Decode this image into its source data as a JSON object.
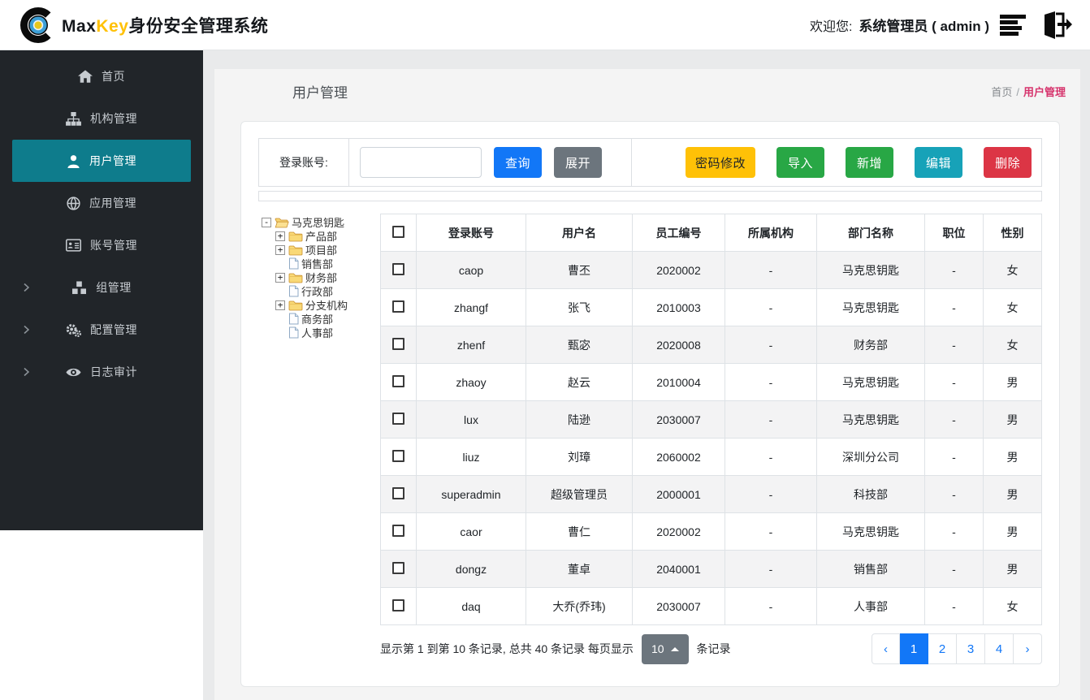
{
  "header": {
    "brand_black": "Max",
    "brand_gold": "Key",
    "brand_suffix": "身份安全管理系统",
    "welcome_label": "欢迎您:",
    "username": "系统管理员 ( admin )"
  },
  "sidebar": {
    "items": [
      {
        "label": "首页",
        "icon": "home-icon",
        "active": false,
        "has_children": false
      },
      {
        "label": "机构管理",
        "icon": "sitemap-icon",
        "active": false,
        "has_children": false
      },
      {
        "label": "用户管理",
        "icon": "user-icon",
        "active": true,
        "has_children": false
      },
      {
        "label": "应用管理",
        "icon": "globe-icon",
        "active": false,
        "has_children": false
      },
      {
        "label": "账号管理",
        "icon": "id-card-icon",
        "active": false,
        "has_children": false
      },
      {
        "label": "组管理",
        "icon": "cubes-icon",
        "active": false,
        "has_children": true
      },
      {
        "label": "配置管理",
        "icon": "gears-icon",
        "active": false,
        "has_children": true
      },
      {
        "label": "日志审计",
        "icon": "eye-icon",
        "active": false,
        "has_children": true
      }
    ]
  },
  "page": {
    "title": "用户管理",
    "breadcrumb_home": "首页",
    "breadcrumb_separator": "/",
    "breadcrumb_current": "用户管理"
  },
  "search": {
    "label": "登录账号:",
    "input_value": "",
    "query_button": "查询",
    "expand_button": "展开"
  },
  "actions": {
    "password_button": "密码修改",
    "import_button": "导入",
    "add_button": "新增",
    "edit_button": "编辑",
    "delete_button": "删除"
  },
  "tree": {
    "nodes": [
      {
        "label": "马克思钥匙",
        "type": "folder-open",
        "expander": "minus",
        "level": 0
      },
      {
        "label": "产品部",
        "type": "folder",
        "expander": "plus",
        "level": 1
      },
      {
        "label": "项目部",
        "type": "folder",
        "expander": "plus",
        "level": 1
      },
      {
        "label": "销售部",
        "type": "file",
        "expander": "none",
        "level": 1
      },
      {
        "label": "财务部",
        "type": "folder",
        "expander": "plus",
        "level": 1
      },
      {
        "label": "行政部",
        "type": "file",
        "expander": "none",
        "level": 1
      },
      {
        "label": "分支机构",
        "type": "folder",
        "expander": "plus",
        "level": 1
      },
      {
        "label": "商务部",
        "type": "file",
        "expander": "none",
        "level": 1
      },
      {
        "label": "人事部",
        "type": "file",
        "expander": "none",
        "level": 1
      }
    ]
  },
  "table": {
    "columns": [
      "登录账号",
      "用户名",
      "员工编号",
      "所属机构",
      "部门名称",
      "职位",
      "性别"
    ],
    "rows": [
      [
        "caop",
        "曹丕",
        "2020002",
        "-",
        "马克思钥匙",
        "-",
        "女"
      ],
      [
        "zhangf",
        "张飞",
        "2010003",
        "-",
        "马克思钥匙",
        "-",
        "女"
      ],
      [
        "zhenf",
        "甄宓",
        "2020008",
        "-",
        "财务部",
        "-",
        "女"
      ],
      [
        "zhaoy",
        "赵云",
        "2010004",
        "-",
        "马克思钥匙",
        "-",
        "男"
      ],
      [
        "lux",
        "陆逊",
        "2030007",
        "-",
        "马克思钥匙",
        "-",
        "男"
      ],
      [
        "liuz",
        "刘璋",
        "2060002",
        "-",
        "深圳分公司",
        "-",
        "男"
      ],
      [
        "superadmin",
        "超级管理员",
        "2000001",
        "-",
        "科技部",
        "-",
        "男"
      ],
      [
        "caor",
        "曹仁",
        "2020002",
        "-",
        "马克思钥匙",
        "-",
        "男"
      ],
      [
        "dongz",
        "董卓",
        "2040001",
        "-",
        "销售部",
        "-",
        "男"
      ],
      [
        "daq",
        "大乔(乔玮)",
        "2030007",
        "-",
        "人事部",
        "-",
        "女"
      ]
    ]
  },
  "pagination": {
    "summary_prefix": "显示第 1 到第 10 条记录, 总共 40 条记录  每页显示",
    "page_size": "10",
    "summary_suffix": "条记录",
    "prev": "‹",
    "next": "›",
    "pages": [
      "1",
      "2",
      "3",
      "4"
    ],
    "active_page": "1"
  },
  "colors": {
    "primary_blue": "#1277f7",
    "secondary_gray": "#6c757d",
    "warning_yellow": "#ffc107",
    "success_green": "#28a745",
    "info_teal": "#17a2b8",
    "danger_red": "#dc3545",
    "sidebar_bg": "#212529",
    "sidebar_active_teal": "#0e7c8c",
    "breadcrumb_current_pink": "#d6336c",
    "brand_gold": "#ffc107"
  }
}
